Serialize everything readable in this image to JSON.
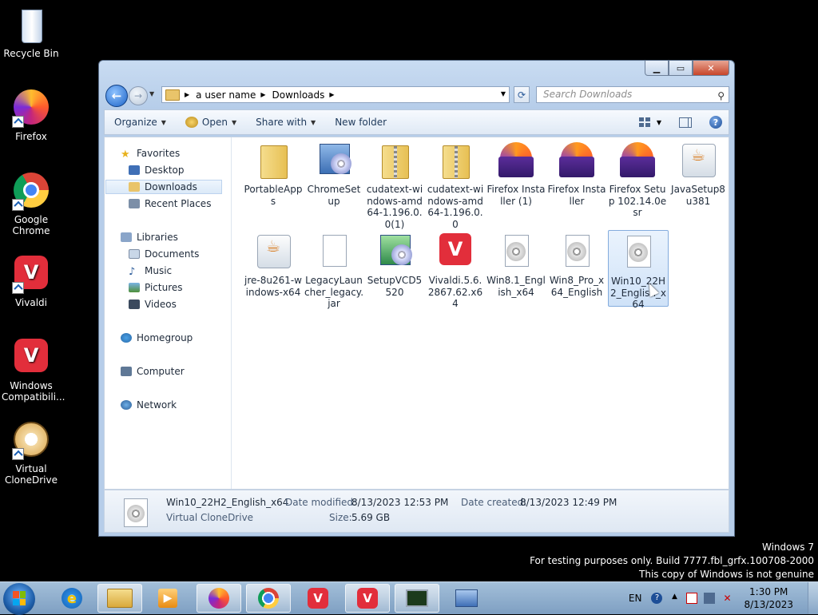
{
  "desktop": {
    "icons": [
      {
        "label": "Recycle Bin",
        "icon": "recycle-bin-icon"
      },
      {
        "label": "Firefox",
        "icon": "firefox-icon"
      },
      {
        "label": "Google Chrome",
        "icon": "chrome-icon"
      },
      {
        "label": "Vivaldi",
        "icon": "vivaldi-icon"
      },
      {
        "label": "Windows Compatibili...",
        "icon": "vivaldi-icon"
      },
      {
        "label": "Virtual CloneDrive",
        "icon": "virtual-clonedrive-icon"
      }
    ]
  },
  "window": {
    "breadcrumb": [
      "a user name",
      "Downloads"
    ],
    "search_placeholder": "Search Downloads",
    "toolbar": {
      "organize": "Organize",
      "open": "Open",
      "share_with": "Share with",
      "new_folder": "New folder"
    },
    "navpane": {
      "favorites": "Favorites",
      "desktop": "Desktop",
      "downloads": "Downloads",
      "recent_places": "Recent Places",
      "libraries": "Libraries",
      "documents": "Documents",
      "music": "Music",
      "pictures": "Pictures",
      "videos": "Videos",
      "homegroup": "Homegroup",
      "computer": "Computer",
      "network": "Network"
    },
    "files": [
      {
        "name": "PortableApps",
        "icon": "folder-icon"
      },
      {
        "name": "ChromeSetup",
        "icon": "setup-disc-icon"
      },
      {
        "name": "cudatext-windows-amd64-1.196.0.0(1)",
        "icon": "zip-folder-icon"
      },
      {
        "name": "cudatext-windows-amd64-1.196.0.0",
        "icon": "zip-folder-icon"
      },
      {
        "name": "Firefox Installer (1)",
        "icon": "firefox-installer-icon"
      },
      {
        "name": "Firefox Installer",
        "icon": "firefox-installer-icon"
      },
      {
        "name": "Firefox Setup 102.14.0esr",
        "icon": "firefox-installer-icon"
      },
      {
        "name": "JavaSetup8u381",
        "icon": "java-setup-icon"
      },
      {
        "name": "jre-8u261-windows-x64",
        "icon": "java-setup-icon"
      },
      {
        "name": "LegacyLauncher_legacy.jar",
        "icon": "blank-document-icon"
      },
      {
        "name": "SetupVCD5520",
        "icon": "setup-box-icon"
      },
      {
        "name": "Vivaldi.5.6.2867.62.x64",
        "icon": "vivaldi-icon"
      },
      {
        "name": "Win8.1_English_x64",
        "icon": "disc-image-icon"
      },
      {
        "name": "Win8_Pro_x64_English",
        "icon": "disc-image-icon"
      },
      {
        "name": "Win10_22H2_English_x64",
        "icon": "disc-image-icon"
      }
    ],
    "details": {
      "name": "Win10_22H2_English_x64",
      "type": "Virtual CloneDrive",
      "modified_label": "Date modified:",
      "modified_value": "8/13/2023 12:53 PM",
      "created_label": "Date created:",
      "created_value": "8/13/2023 12:49 PM",
      "size_label": "Size:",
      "size_value": "5.69 GB"
    }
  },
  "watermark": {
    "line1": "Windows 7",
    "line2": "For testing purposes only. Build 7777.fbl_grfx.100708-2000",
    "line3": "This copy of Windows is not genuine"
  },
  "taskbar": {
    "language": "EN",
    "time": "1:30 PM",
    "date": "8/13/2023"
  },
  "colors": {
    "desktop_bg": "#000000",
    "selection": "#cfe2f8",
    "taskbar": "#8fadd0"
  }
}
